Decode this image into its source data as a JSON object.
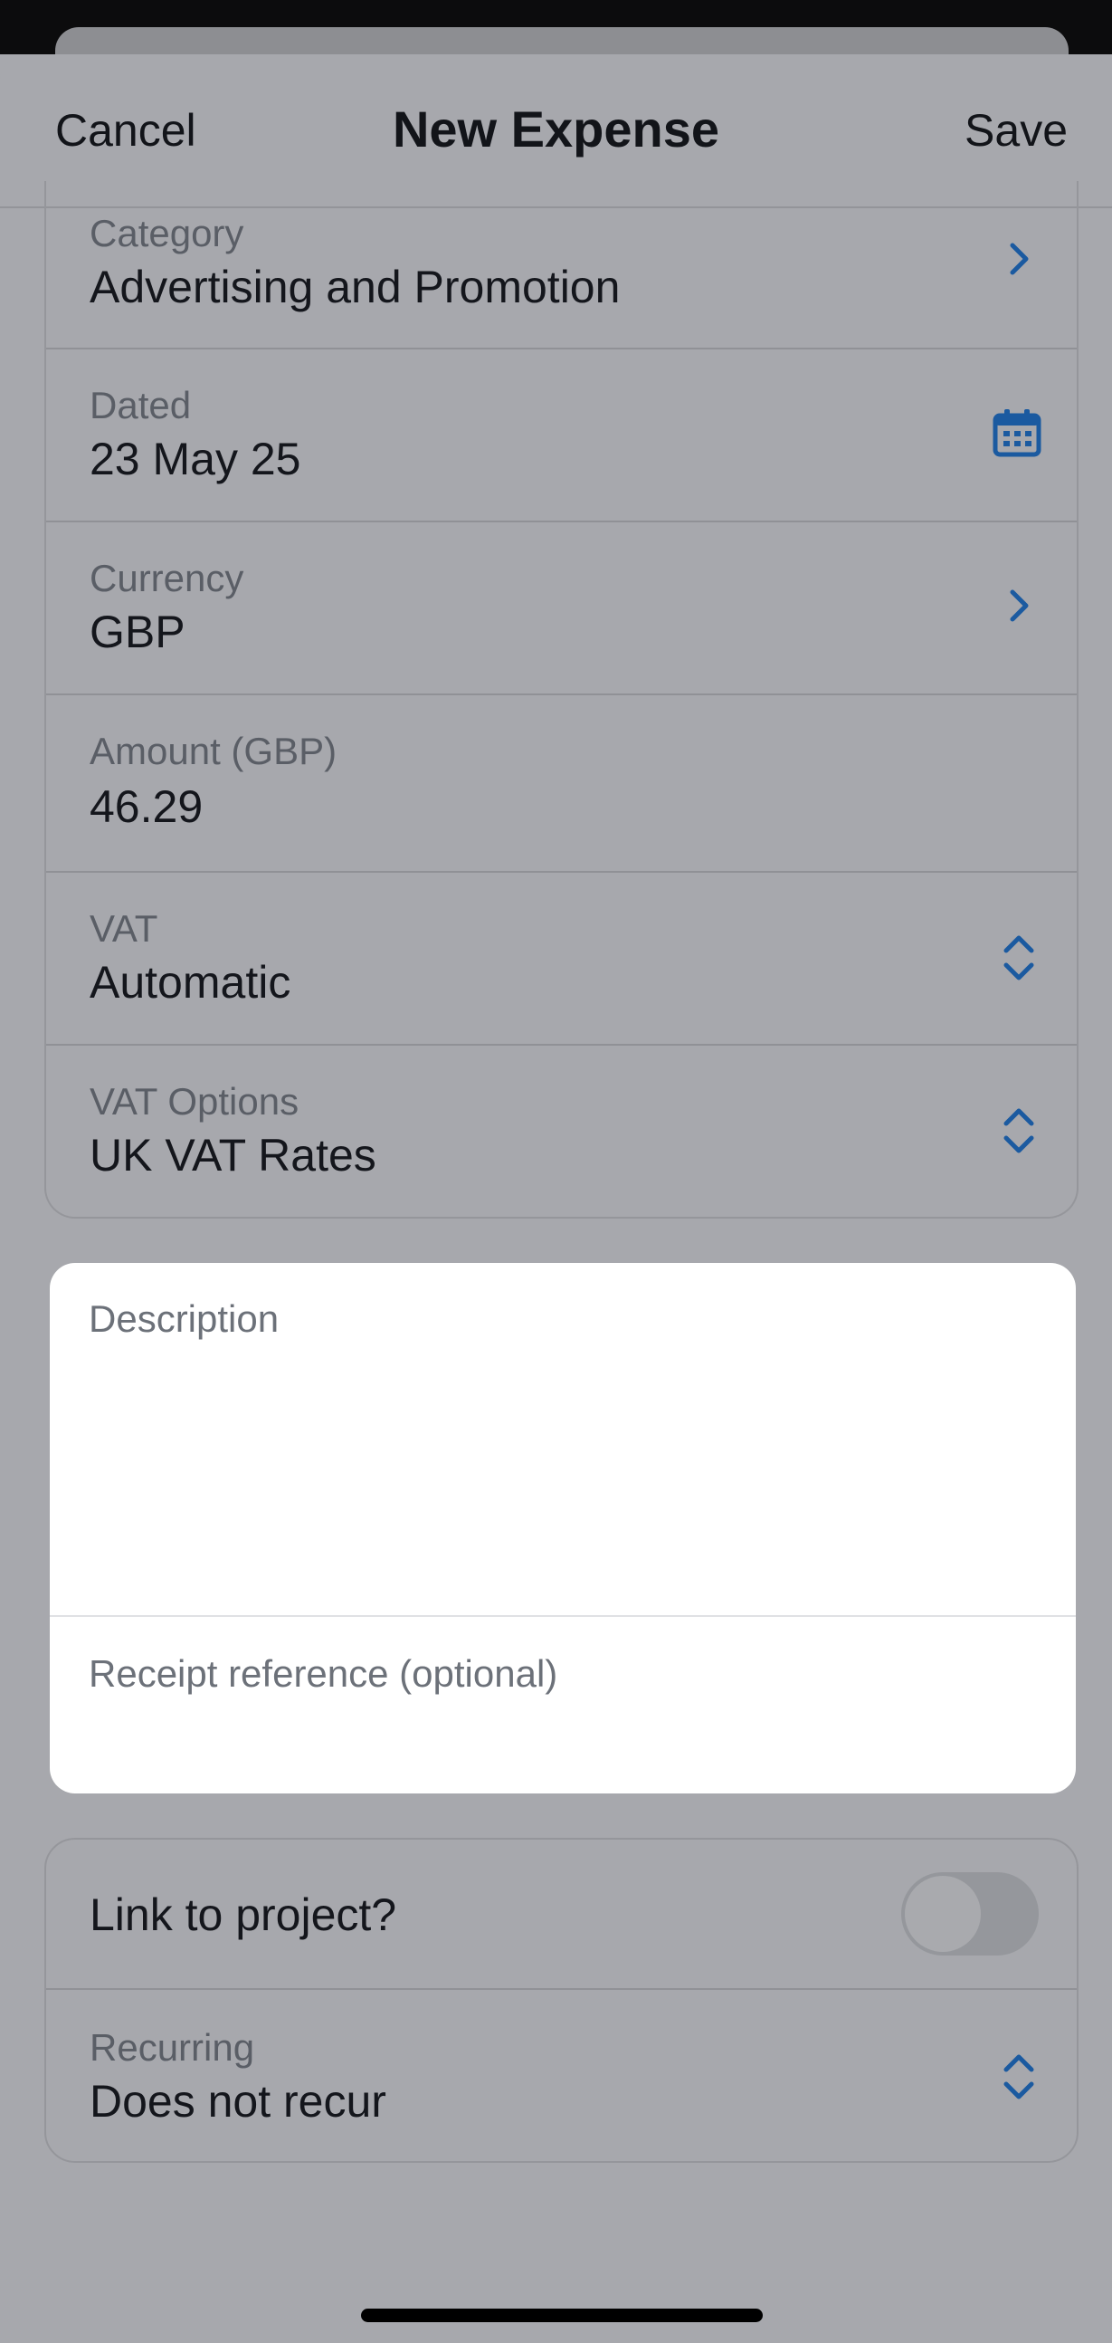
{
  "nav": {
    "cancel": "Cancel",
    "title": "New Expense",
    "save": "Save"
  },
  "fields": {
    "category": {
      "label": "Category",
      "value": "Advertising and Promotion",
      "icon": "chevron-right-icon"
    },
    "dated": {
      "label": "Dated",
      "value": "23 May 25",
      "icon": "calendar-icon"
    },
    "currency": {
      "label": "Currency",
      "value": "GBP",
      "icon": "chevron-right-icon"
    },
    "amount": {
      "label": "Amount (GBP)",
      "value": "46.29"
    },
    "vat": {
      "label": "VAT",
      "value": "Automatic",
      "icon": "up-down-chevron-icon"
    },
    "vat_options": {
      "label": "VAT Options",
      "value": "UK VAT Rates",
      "icon": "up-down-chevron-icon"
    }
  },
  "description": {
    "placeholder": "Description"
  },
  "receipt": {
    "placeholder": "Receipt reference (optional)"
  },
  "project": {
    "label": "Link to project?",
    "toggle_on": false
  },
  "recurring": {
    "label": "Recurring",
    "value": "Does not recur",
    "icon": "up-down-chevron-icon"
  },
  "colors": {
    "accent": "#1b5aa0",
    "overlay": "#a7a8ad",
    "card": "#ffffff"
  }
}
